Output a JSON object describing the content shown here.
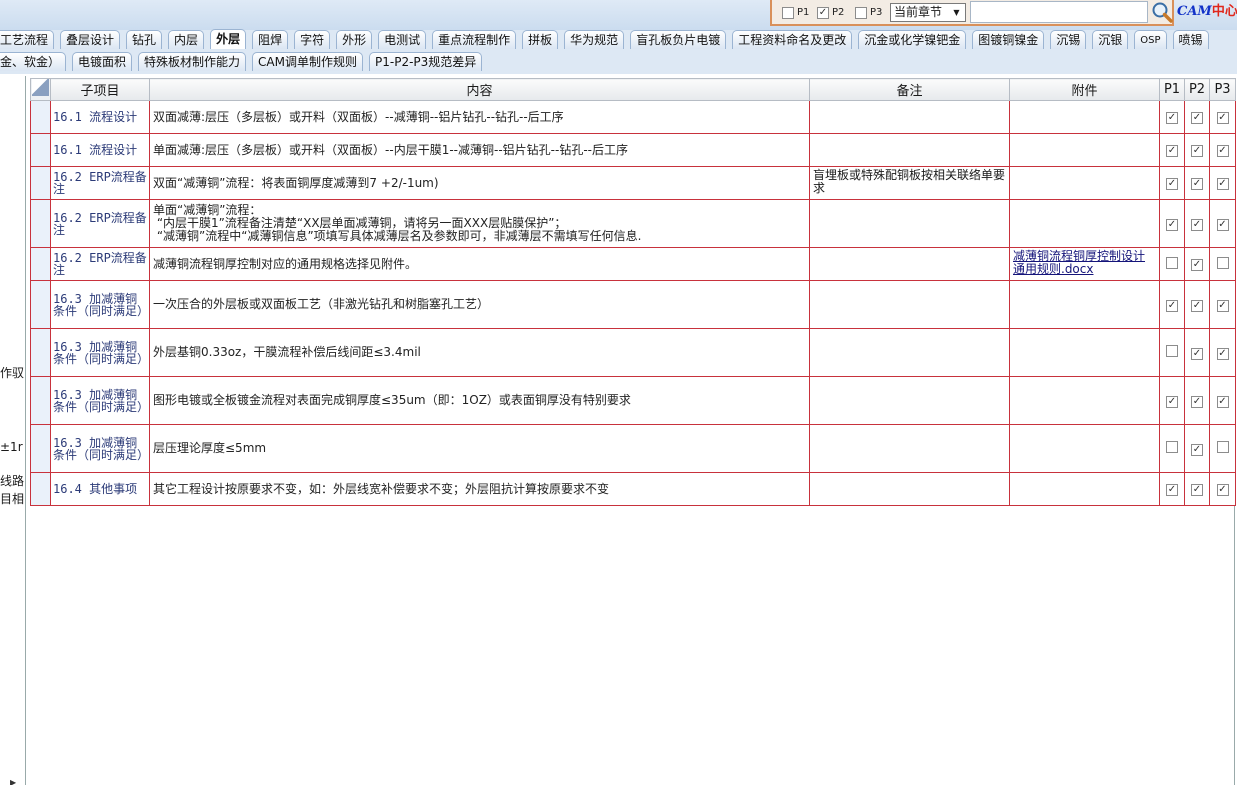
{
  "toolbar": {
    "filters": [
      {
        "label": "P1",
        "checked": false
      },
      {
        "label": "P2",
        "checked": true
      },
      {
        "label": "P3",
        "checked": false
      }
    ],
    "scope_value": "当前章节",
    "search_value": "",
    "logo_prefix": "CAM",
    "logo_suffix": "中心",
    "icons": {
      "search": "magnifier-icon",
      "dropdown": "chevron-down-icon"
    }
  },
  "tabs_row1": [
    {
      "label": "工艺流程"
    },
    {
      "label": "叠层设计"
    },
    {
      "label": "钻孔"
    },
    {
      "label": "内层"
    },
    {
      "label": "外层",
      "active": true
    },
    {
      "label": "阻焊"
    },
    {
      "label": "字符"
    },
    {
      "label": "外形"
    },
    {
      "label": "电测试"
    },
    {
      "label": "重点流程制作"
    },
    {
      "label": "拼板"
    },
    {
      "label": "华为规范"
    },
    {
      "label": "盲孔板负片电镀"
    },
    {
      "label": "工程资料命名及更改"
    },
    {
      "label": "沉金或化学镍钯金"
    },
    {
      "label": "图镀铜镍金"
    },
    {
      "label": "沉锡"
    },
    {
      "label": "沉银"
    },
    {
      "label": "OSP"
    },
    {
      "label": "喷锡"
    }
  ],
  "tabs_row2": [
    {
      "label": "金、软金）"
    },
    {
      "label": "电镀面积"
    },
    {
      "label": "特殊板材制作能力"
    },
    {
      "label": "CAM调单制作规则"
    },
    {
      "label": "P1-P2-P3规范差异"
    }
  ],
  "left_strip_fragments": [
    "作驭",
    "±1r",
    "线路",
    "目相"
  ],
  "table": {
    "headers": {
      "subitem": "子项目",
      "content": "内容",
      "note": "备注",
      "attachment": "附件",
      "p1": "P1",
      "p2": "P2",
      "p3": "P3"
    },
    "rows": [
      {
        "sub": "16.1 流程设计",
        "content": [
          "双面减薄:层压（多层板）或开料（双面板）--减薄铜--铝片钻孔--钻孔--后工序"
        ],
        "note": "",
        "attachment": "",
        "p1": true,
        "p2": true,
        "p3": true
      },
      {
        "sub": "16.1 流程设计",
        "content": [
          "单面减薄:层压（多层板）或开料（双面板）--内层干膜1--减薄铜--铝片钻孔--钻孔--后工序"
        ],
        "note": "",
        "attachment": "",
        "p1": true,
        "p2": true,
        "p3": true
      },
      {
        "sub": "16.2 ERP流程备注",
        "content": [
          "双面“减薄铜”流程：将表面铜厚度减薄到7 +2/-1um)"
        ],
        "note": "盲埋板或特殊配铜板按相关联络单要求",
        "attachment": "",
        "p1": true,
        "p2": true,
        "p3": true
      },
      {
        "sub": "16.2 ERP流程备注",
        "content": [
          "单面“减薄铜”流程：",
          " “内层干膜1”流程备注清楚“XX层单面减薄铜，请将另一面XXX层贴膜保护”；",
          " “减薄铜”流程中“减薄铜信息”项填写具体减薄层名及参数即可，非减薄层不需填写任何信息."
        ],
        "note": "",
        "attachment": "",
        "p1": true,
        "p2": true,
        "p3": true
      },
      {
        "sub": "16.2 ERP流程备注",
        "content": [
          "减薄铜流程铜厚控制对应的通用规格选择见附件。"
        ],
        "note": "",
        "attachment": "减薄铜流程铜厚控制设计通用规则.docx",
        "p1": false,
        "p2": true,
        "p3": false
      },
      {
        "sub": "16.3 加减薄铜条件（同时满足）",
        "content": [
          "一次压合的外层板或双面板工艺（非激光钻孔和树脂塞孔工艺）"
        ],
        "note": "",
        "attachment": "",
        "p1": true,
        "p2": true,
        "p3": true
      },
      {
        "sub": "16.3 加减薄铜条件（同时满足）",
        "content": [
          "外层基铜0.33oz，干膜流程补偿后线间距≤3.4mil"
        ],
        "note": "",
        "attachment": "",
        "p1": false,
        "p2": true,
        "p3": true
      },
      {
        "sub": "16.3 加减薄铜条件（同时满足）",
        "content": [
          "图形电镀或全板镀金流程对表面完成铜厚度≤35um（即：1OZ）或表面铜厚没有特别要求"
        ],
        "note": "",
        "attachment": "",
        "p1": true,
        "p2": true,
        "p3": true
      },
      {
        "sub": "16.3 加减薄铜条件（同时满足）",
        "content": [
          "层压理论厚度≤5mm"
        ],
        "note": "",
        "attachment": "",
        "p1": false,
        "p2": true,
        "p3": false
      },
      {
        "sub": "16.4 其他事项",
        "content": [
          "其它工程设计按原要求不变，如：外层线宽补偿要求不变；外层阻抗计算按原要求不变"
        ],
        "note": "",
        "attachment": "",
        "p1": true,
        "p2": true,
        "p3": true
      }
    ]
  },
  "colors": {
    "grid_border": "#c8323c",
    "tab_bg": "#dde8f4",
    "search_frame": "#d9905a",
    "link": "#14147a"
  }
}
